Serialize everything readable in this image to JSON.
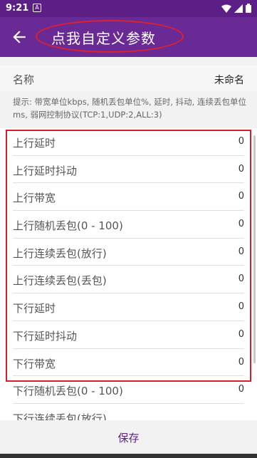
{
  "status_bar": {
    "time": "9:21",
    "notif_glyph": "A",
    "icons": [
      "wifi-icon",
      "signal-icon",
      "battery-icon"
    ]
  },
  "app_bar": {
    "title": "点我自定义参数",
    "back_icon": "arrow-back-icon"
  },
  "name_row": {
    "label": "名称",
    "value": "未命名"
  },
  "hint": "提示: 带宽单位kbps, 随机丢包单位%, 延时, 抖动, 连续丢包单位ms, 弱网控制协议(TCP:1,UDP:2,ALL:3)",
  "params": [
    {
      "label": "上行延时",
      "value": "0"
    },
    {
      "label": "上行延时抖动",
      "value": "0"
    },
    {
      "label": "上行带宽",
      "value": "0"
    },
    {
      "label": "上行随机丢包(0 - 100)",
      "value": "0"
    },
    {
      "label": "上行连续丢包(放行)",
      "value": "0"
    },
    {
      "label": "上行连续丢包(丢包)",
      "value": "0"
    },
    {
      "label": "下行延时",
      "value": "0"
    },
    {
      "label": "下行延时抖动",
      "value": "0"
    },
    {
      "label": "下行带宽",
      "value": "0"
    },
    {
      "label": "下行随机丢包(0 - 100)",
      "value": "0"
    },
    {
      "label": "下行连续丢包(放行)",
      "value": ""
    }
  ],
  "footer": {
    "save_label": "保存"
  },
  "colors": {
    "status_bar": "#5b1f86",
    "app_bar": "#6a2a96",
    "accent": "#5b1f86",
    "annotation": "#d4202a"
  }
}
